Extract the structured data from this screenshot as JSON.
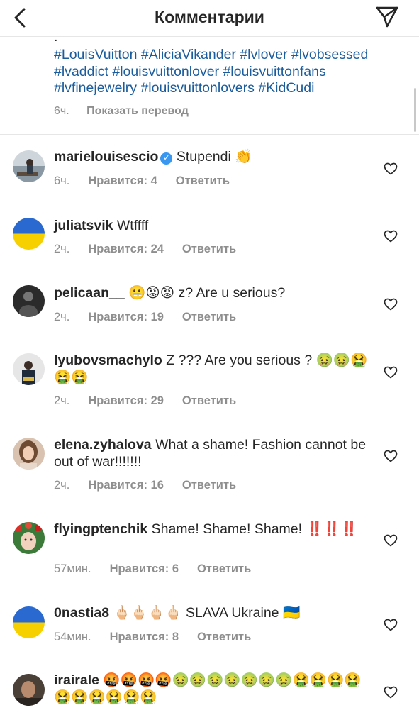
{
  "header": {
    "title": "Комментарии"
  },
  "caption": {
    "dot": ".",
    "hashtags": "#LouisVuitton #AliciaVikander #lvlover #lvobsessed #lvaddict #louisvuittonlover #louisvuittonfans #lvfinejewelry #louisvuittonlovers #KidCudi",
    "age": "6ч.",
    "translate": "Показать перевод"
  },
  "comments": [
    {
      "username": "marielouisescio",
      "verified": true,
      "text": "Stupendi 👏",
      "age": "6ч.",
      "likes": "Нравится: 4",
      "reply": "Ответить"
    },
    {
      "username": "juliatsvik",
      "text": "Wtffff",
      "age": "2ч.",
      "likes": "Нравится: 24",
      "reply": "Ответить"
    },
    {
      "username": "pelicaan__",
      "text": "😬😡😡 z? Are u serious?",
      "age": "2ч.",
      "likes": "Нравится: 19",
      "reply": "Ответить"
    },
    {
      "username": "lyubovsmachylo",
      "text": "Z ??? Are you serious ? 🤢🤢🤮🤮🤮",
      "age": "2ч.",
      "likes": "Нравится: 29",
      "reply": "Ответить"
    },
    {
      "username": "elena.zyhalova",
      "text": "What a shame! Fashion cannot be out of war!!!!!!!",
      "age": "2ч.",
      "likes": "Нравится: 16",
      "reply": "Ответить"
    },
    {
      "username": "flyingptenchik",
      "text": "Shame! Shame! Shame! ‼️‼️‼️",
      "age": "57мин.",
      "likes": "Нравится: 6",
      "reply": "Ответить"
    },
    {
      "username": "0nastia8",
      "text": "🖕🏻🖕🏻🖕🏻🖕🏻 SLAVA Ukraine 🇺🇦",
      "age": "54мин.",
      "likes": "Нравится: 8",
      "reply": "Ответить"
    },
    {
      "username": "irairale",
      "text": "🤬🤬🤬🤬🤢🤢🤢🤢🤢🤢🤢🤮🤮🤮🤮🤮🤮🤮🤮🤮🤮",
      "age": "",
      "likes": "",
      "reply": ""
    }
  ],
  "colors": {
    "link": "#1a5c9c",
    "text": "#262626",
    "secondary": "#8e8e8e",
    "verified": "#3897f0",
    "flag_blue": "#2a6ad0",
    "flag_yellow": "#f7d000"
  },
  "icons": {
    "back": "chevron-left-icon",
    "send": "paper-plane-icon",
    "like": "heart-outline-icon",
    "verified": "verified-badge-icon"
  }
}
